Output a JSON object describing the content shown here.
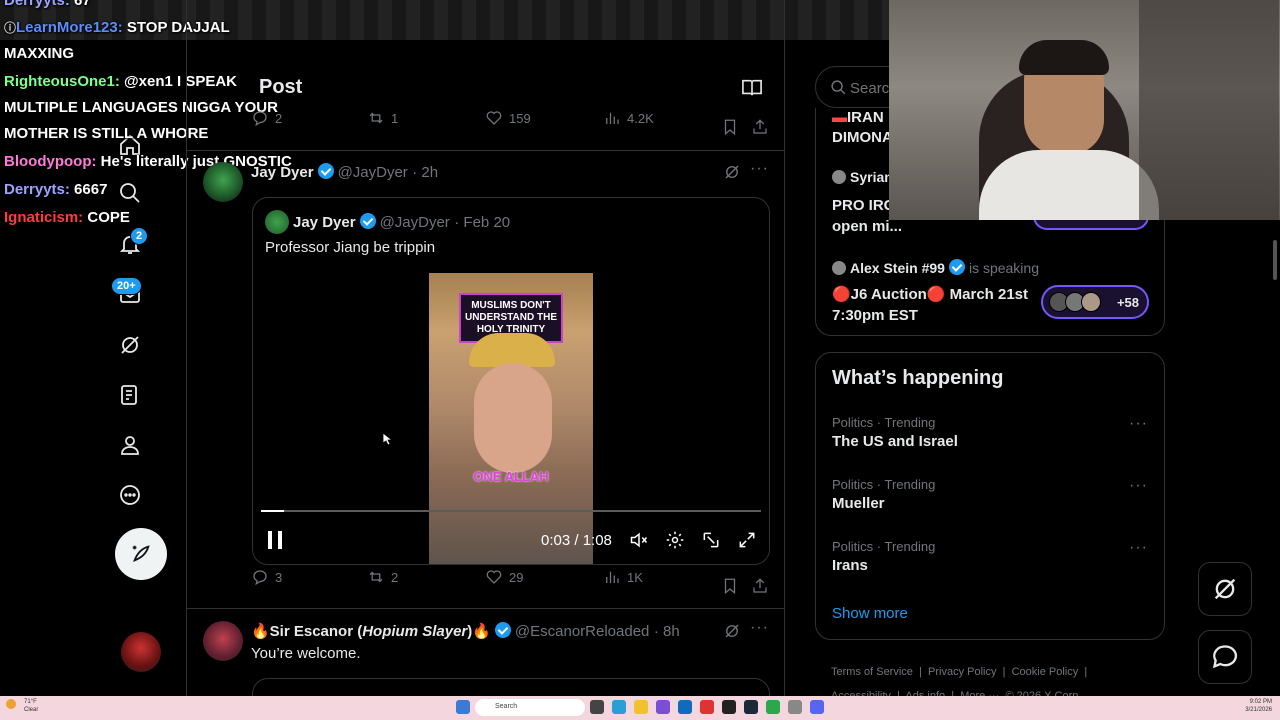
{
  "chat": [
    {
      "user": "Derryyts:",
      "msg": "67",
      "color": "#9aa5ff"
    },
    {
      "user": "LearnMore123:",
      "msg": "STOP DAJJAL MAXXING",
      "color": "#5b8dff"
    },
    {
      "user": "RighteousOne1:",
      "msg": "@xen1 I SPEAK MULTIPLE LANGUAGES NIGGA YOUR MOTHER IS STILL A WHORE",
      "color": "#7dff8a"
    },
    {
      "user": "Bloodypoop:",
      "msg": "He's literally just GNOSTIC",
      "color": "#ff7ad9"
    },
    {
      "user": "Derryyts:",
      "msg": "6667",
      "color": "#9aa5ff"
    },
    {
      "user": "Ignaticism:",
      "msg": "COPE",
      "color": "#ff3b3b"
    }
  ],
  "header": {
    "title": "Post"
  },
  "top_actions": {
    "replies": "2",
    "reposts": "1",
    "likes": "159",
    "views": "4.2K"
  },
  "post": {
    "name": "Jay Dyer",
    "handle": "@JayDyer",
    "time": "· 2h",
    "quote": {
      "name": "Jay Dyer",
      "handle": "@JayDyer",
      "time": "· Feb 20",
      "text": "Professor Jiang be trippin"
    },
    "video": {
      "caption_top": "MUSLIMS DON'T UNDERSTAND THE HOLY TRINITY",
      "caption_bottom": "ONE ALLAH",
      "time": "0:03 / 1:08",
      "progress": 0.046
    },
    "actions": {
      "replies": "3",
      "reposts": "2",
      "likes": "29",
      "views": "1K"
    }
  },
  "reply": {
    "name_prefix": "🔥Sir Escanor (",
    "name_italic": "Hopium Slayer",
    "name_suffix": ")🔥",
    "handle": "@EscanorReloaded",
    "time": "· 8h",
    "text": "You’re welcome."
  },
  "sidebar": {
    "notif_badge": "2",
    "msg_badge": "20+"
  },
  "search": {
    "placeholder": "Search"
  },
  "spaces": [
    {
      "host": "IRAN",
      "title": "DIMONA"
    },
    {
      "host": "Syrian",
      "title": "PRO IRG... Monarchists🇮🇷 open mi..."
    },
    {
      "host": "Alex Stein #99",
      "status": "is speaking",
      "title": "🔴J6 Auction🔴 March 21st 7:30pm EST",
      "count": "+58"
    }
  ],
  "happening": {
    "title": "What’s happening",
    "trends": [
      {
        "category": "Politics · Trending",
        "name": "The US and Israel"
      },
      {
        "category": "Politics · Trending",
        "name": "Mueller"
      },
      {
        "category": "Politics · Trending",
        "name": "Irans"
      }
    ],
    "show_more": "Show more"
  },
  "footer": {
    "terms": "Terms of Service",
    "privacy": "Privacy Policy",
    "cookie": "Cookie Policy",
    "access": "Accessibility",
    "ads": "Ads info",
    "more": "More ···",
    "copy": "© 2026 X Corp."
  },
  "taskbar": {
    "weather": "71°F",
    "weather_sub": "Clear",
    "search": "Search",
    "time": "9:02 PM",
    "date": "3/21/2026"
  },
  "colors": {
    "accent": "#1d9bf0",
    "taskbar": "#f3d6de"
  }
}
